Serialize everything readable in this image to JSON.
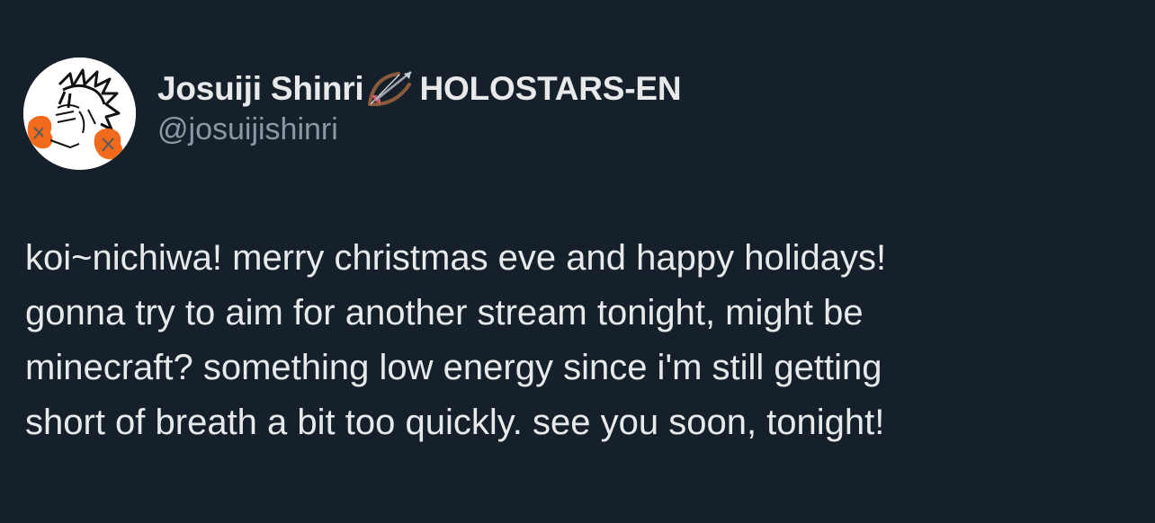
{
  "author": {
    "display_name": "Josuiji Shinri",
    "affiliation": "HOLOSTARS-EN",
    "handle": "@josuijishinri",
    "name_emoji": "bow-and-arrow-icon"
  },
  "tweet": {
    "text": "koi~nichiwa! merry christmas eve and happy holidays!\ngonna try to aim for another stream tonight, might be\nminecraft? something low energy since i'm still getting\nshort of breath a bit too quickly. see you soon, tonight!"
  },
  "colors": {
    "background": "#15202b",
    "primary_text": "#e7e9ea",
    "secondary_text": "#8b98a5",
    "avatar_accent": "#f26a1b"
  }
}
